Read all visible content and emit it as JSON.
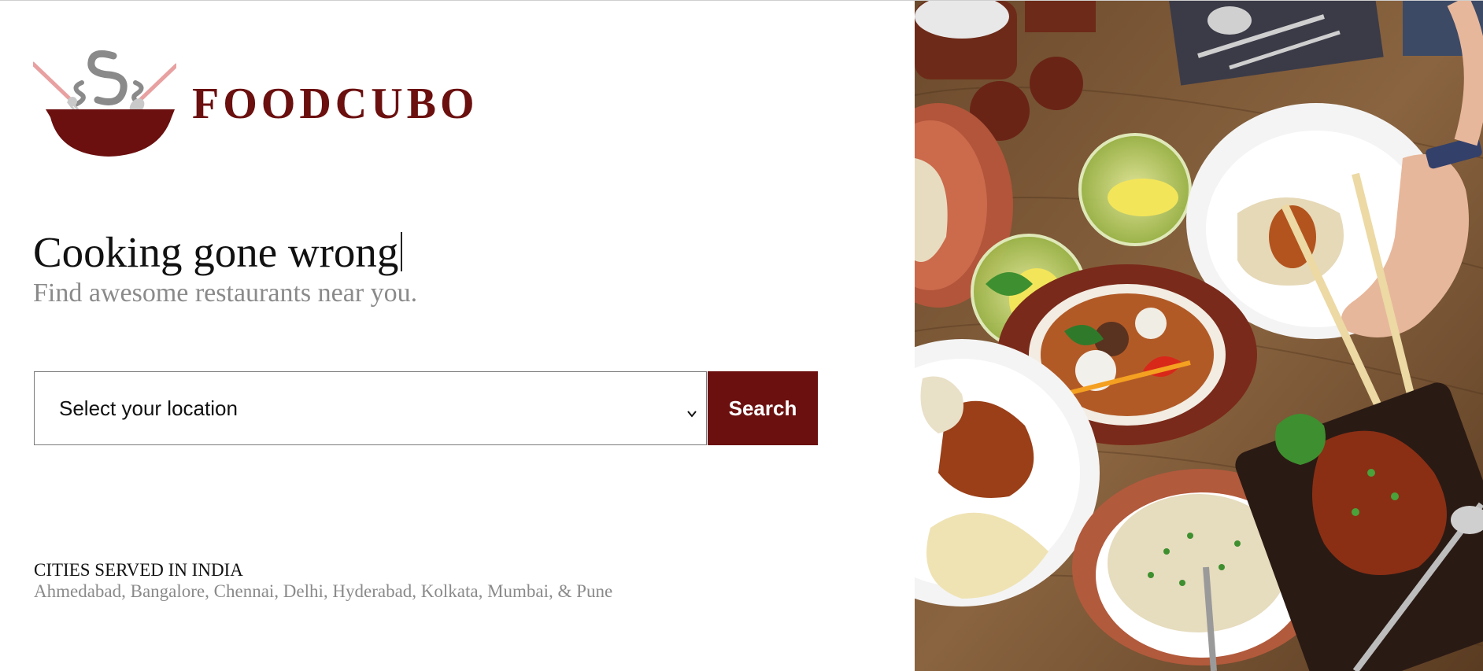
{
  "brand": {
    "name": "FOODCUBO",
    "logo_icon": "cooking-pot-logo",
    "color": "#6b0f0f"
  },
  "hero": {
    "headline": "Cooking gone wrong",
    "subheadline": "Find awesome restaurants near you."
  },
  "search": {
    "location_select": {
      "value": "Select your location",
      "icon": "chevron-down-icon"
    },
    "button_label": "Search"
  },
  "cities": {
    "heading": "CITIES SERVED IN INDIA",
    "list": "Ahmedabad, Bangalore, Chennai, Delhi, Hyderabad, Kolkata, Mumbai, & Pune"
  },
  "image": {
    "subject": "food-table-photo"
  },
  "colors": {
    "accent": "#6b0f0f",
    "muted_text": "#8a8a8a",
    "text": "#111111"
  }
}
